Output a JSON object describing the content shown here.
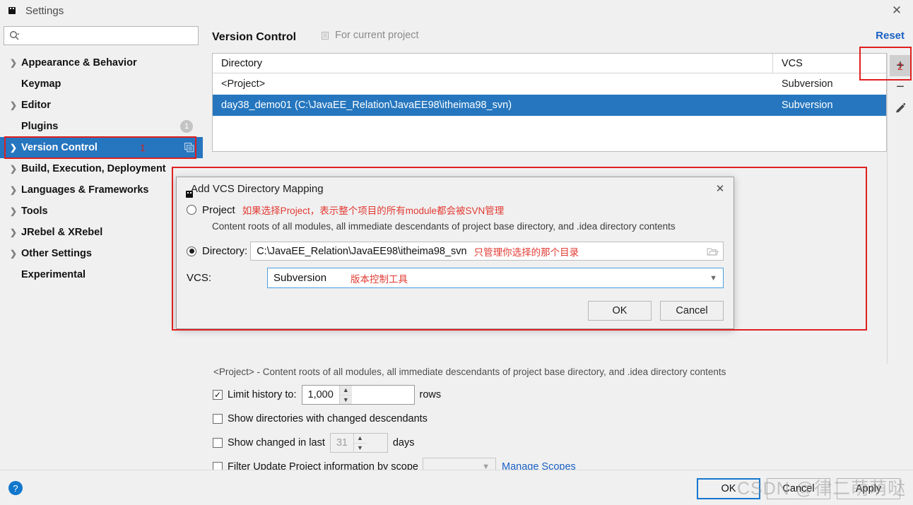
{
  "window": {
    "title": "Settings",
    "app_icon": "jetbrains-logo-icon",
    "close_label": "✕"
  },
  "search": {
    "value": "",
    "placeholder": "",
    "icon": "search-icon"
  },
  "sidebar": {
    "items": [
      {
        "label": "Appearance & Behavior",
        "expandable": true,
        "selected": false
      },
      {
        "label": "Keymap",
        "expandable": false,
        "selected": false
      },
      {
        "label": "Editor",
        "expandable": true,
        "selected": false
      },
      {
        "label": "Plugins",
        "expandable": false,
        "selected": false,
        "badge": "1"
      },
      {
        "label": "Version Control",
        "expandable": true,
        "selected": true,
        "red_number": "1"
      },
      {
        "label": "Build, Execution, Deployment",
        "expandable": true,
        "selected": false
      },
      {
        "label": "Languages & Frameworks",
        "expandable": true,
        "selected": false
      },
      {
        "label": "Tools",
        "expandable": true,
        "selected": false
      },
      {
        "label": "JRebel & XRebel",
        "expandable": true,
        "selected": false
      },
      {
        "label": "Other Settings",
        "expandable": true,
        "selected": false
      },
      {
        "label": "Experimental",
        "expandable": false,
        "selected": false
      }
    ]
  },
  "main": {
    "title": "Version Control",
    "scope_label": "For current project",
    "scope_icon": "project-scope-icon",
    "reset_label": "Reset",
    "table": {
      "columns": [
        "Directory",
        "VCS"
      ],
      "rows": [
        {
          "directory": "<Project>",
          "vcs": "Subversion",
          "selected": false
        },
        {
          "directory": "day38_demo01 (C:\\JavaEE_Relation\\JavaEE98\\itheima98_svn)",
          "vcs": "Subversion",
          "selected": true
        }
      ]
    },
    "toolbar": {
      "add_label": "+",
      "remove_label": "−",
      "edit_label": "edit-pencil-icon",
      "add_red_number": "2"
    },
    "note": "<Project> - Content roots of all modules, all immediate descendants of project base directory, and .idea directory contents",
    "options": {
      "limit_history": {
        "label": "Limit history to:",
        "checked": true,
        "value": "1,000",
        "suffix": "rows"
      },
      "show_directories": {
        "label": "Show directories with changed descendants",
        "checked": false
      },
      "show_changed_in_last": {
        "label": "Show changed in last",
        "checked": false,
        "value": "31",
        "suffix": "days"
      },
      "filter_by_scope": {
        "label": "Filter Update Project information by scope",
        "checked": false,
        "scope_value": "",
        "manage_link": "Manage Scopes"
      }
    }
  },
  "dialog": {
    "title": "Add VCS Directory Mapping",
    "icon": "jetbrains-logo-icon",
    "close_label": "✕",
    "project_option": {
      "label": "Project",
      "selected": false,
      "annotation": "如果选择Project，表示整个项目的所有module都会被SVN管理",
      "description": "Content roots of all modules, all immediate descendants of project base directory, and .idea directory contents"
    },
    "directory_option": {
      "label": "Directory:",
      "selected": true,
      "value": "C:\\JavaEE_Relation\\JavaEE98\\itheima98_svn",
      "annotation": "只管理你选择的那个目录",
      "browse_icon": "folder-browse-icon"
    },
    "vcs_field": {
      "label": "VCS:",
      "value": "Subversion",
      "annotation": "版本控制工具"
    },
    "ok_label": "OK",
    "cancel_label": "Cancel"
  },
  "bottom": {
    "help_label": "?",
    "ok_label": "OK",
    "cancel_label": "Cancel",
    "apply_label": "Apply"
  },
  "watermark": {
    "text": "CSDN @律二萌萌哒"
  },
  "colors": {
    "selection_blue": "#2576be",
    "link_blue": "#1a61c4",
    "annotation_red": "#e01f1f",
    "chinese_note_red": "#e23a32",
    "panel_bg": "#f0f0f0"
  }
}
